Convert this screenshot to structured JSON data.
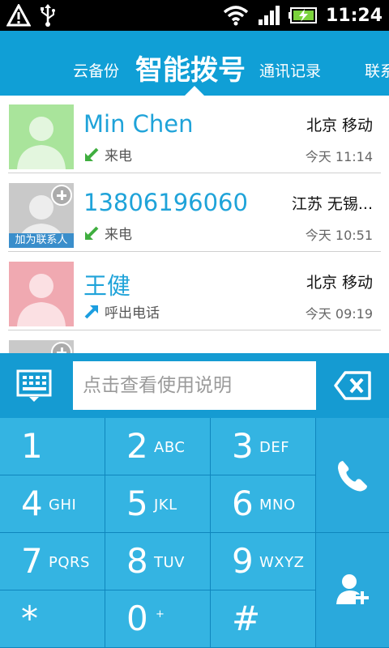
{
  "status_bar": {
    "time": "11:24",
    "icons": [
      "warning-icon",
      "usb-icon",
      "wifi-icon",
      "signal-icon",
      "battery-charging-icon"
    ]
  },
  "header": {
    "tabs": [
      {
        "label": "云备份"
      },
      {
        "label": "智能拨号"
      },
      {
        "label": "通讯记录"
      },
      {
        "label": "联系"
      }
    ],
    "active_tab": "智能拨号"
  },
  "call_log": [
    {
      "name": "Min Chen",
      "call_type": "来电",
      "direction": "incoming",
      "location": "北京 移动",
      "time": "今天 11:14",
      "avatar": "green"
    },
    {
      "name": "13806196060",
      "call_type": "来电",
      "direction": "incoming",
      "location": "江苏 无锡...",
      "time": "今天 10:51",
      "avatar": "gray",
      "avatar_caption": "加为联系人"
    },
    {
      "name": "王健",
      "call_type": "呼出电话",
      "direction": "outgoing",
      "location": "北京 移动",
      "time": "今天 09:19",
      "avatar": "red"
    }
  ],
  "dialer": {
    "placeholder": "点击查看使用说明",
    "keys": [
      {
        "digit": "1",
        "letters": ""
      },
      {
        "digit": "2",
        "letters": "ABC"
      },
      {
        "digit": "3",
        "letters": "DEF"
      },
      {
        "digit": "4",
        "letters": "GHI"
      },
      {
        "digit": "5",
        "letters": "JKL"
      },
      {
        "digit": "6",
        "letters": "MNO"
      },
      {
        "digit": "7",
        "letters": "PQRS"
      },
      {
        "digit": "8",
        "letters": "TUV"
      },
      {
        "digit": "9",
        "letters": "WXYZ"
      },
      {
        "digit": "*",
        "letters": ""
      },
      {
        "digit": "0",
        "letters": "+"
      },
      {
        "digit": "#",
        "letters": ""
      }
    ],
    "side_buttons": [
      "phone-icon",
      "add-contact-icon"
    ]
  },
  "colors": {
    "accent": "#109fd6",
    "key_bg": "#34b4e2",
    "name_text": "#1fa3d9",
    "incoming_arrow": "#3fae3f",
    "outgoing_arrow": "#1b9ee0"
  }
}
